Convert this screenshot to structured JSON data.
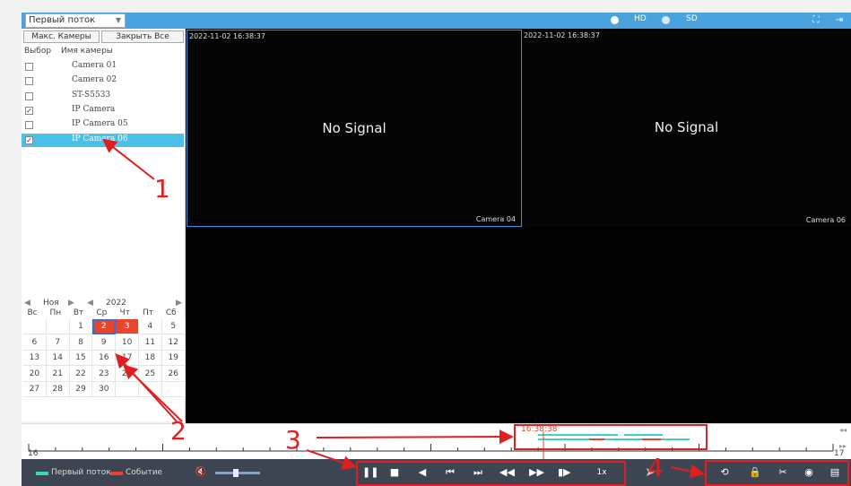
{
  "top_bar": {
    "stream_select": "Первый поток",
    "radio_hd": "HD",
    "radio_sd": "SD"
  },
  "left_panel": {
    "btn_max_cameras": "Макс. Камеры",
    "btn_close_all": "Закрыть Все",
    "col_select": "Выбор",
    "col_camera_name": "Имя камеры",
    "cameras": [
      {
        "name": "Camera 01",
        "checked": false
      },
      {
        "name": "Camera 02",
        "checked": false
      },
      {
        "name": "ST-S5533",
        "checked": false
      },
      {
        "name": "IP Camera",
        "checked": true
      },
      {
        "name": "IP Camera 05",
        "checked": false
      },
      {
        "name": "IP Camera 06",
        "checked": true,
        "selected": true
      }
    ]
  },
  "calendar": {
    "month": "Ноя",
    "year": "2022",
    "weekdays": [
      "Вс",
      "Пн",
      "Вт",
      "Ср",
      "Чт",
      "Пт",
      "Сб"
    ],
    "weeks": [
      [
        "",
        "",
        "1",
        "2",
        "3",
        "4",
        "5"
      ],
      [
        "6",
        "7",
        "8",
        "9",
        "10",
        "11",
        "12"
      ],
      [
        "13",
        "14",
        "15",
        "16",
        "17",
        "18",
        "19"
      ],
      [
        "20",
        "21",
        "22",
        "23",
        "24",
        "25",
        "26"
      ],
      [
        "27",
        "28",
        "29",
        "30",
        "",
        "",
        ""
      ]
    ],
    "recorded_days": [
      "2",
      "3"
    ],
    "current_day": "2"
  },
  "video": {
    "tiles": [
      {
        "timestamp": "2022-11-02 16:38:37",
        "status": "No Signal",
        "camera": "Camera 04"
      },
      {
        "timestamp": "2022-11-02 16:38:37",
        "status": "No Signal",
        "camera": "Camera 06"
      }
    ]
  },
  "timeline": {
    "start_label": "16",
    "end_label": "17",
    "cursor_time": "16:38:38"
  },
  "controls": {
    "legend_stream": "Первый поток",
    "legend_event": "Событие",
    "speed": "1x",
    "volume": 0.4
  },
  "annotations": [
    "1",
    "2",
    "3",
    "4"
  ],
  "colors": {
    "accent": "#4aa3df",
    "selection": "#4ac1ea",
    "recording": "#e8452f",
    "stream_legend": "#3fd1c1",
    "event_legend": "#e8452f",
    "annotation": "#e02020"
  }
}
